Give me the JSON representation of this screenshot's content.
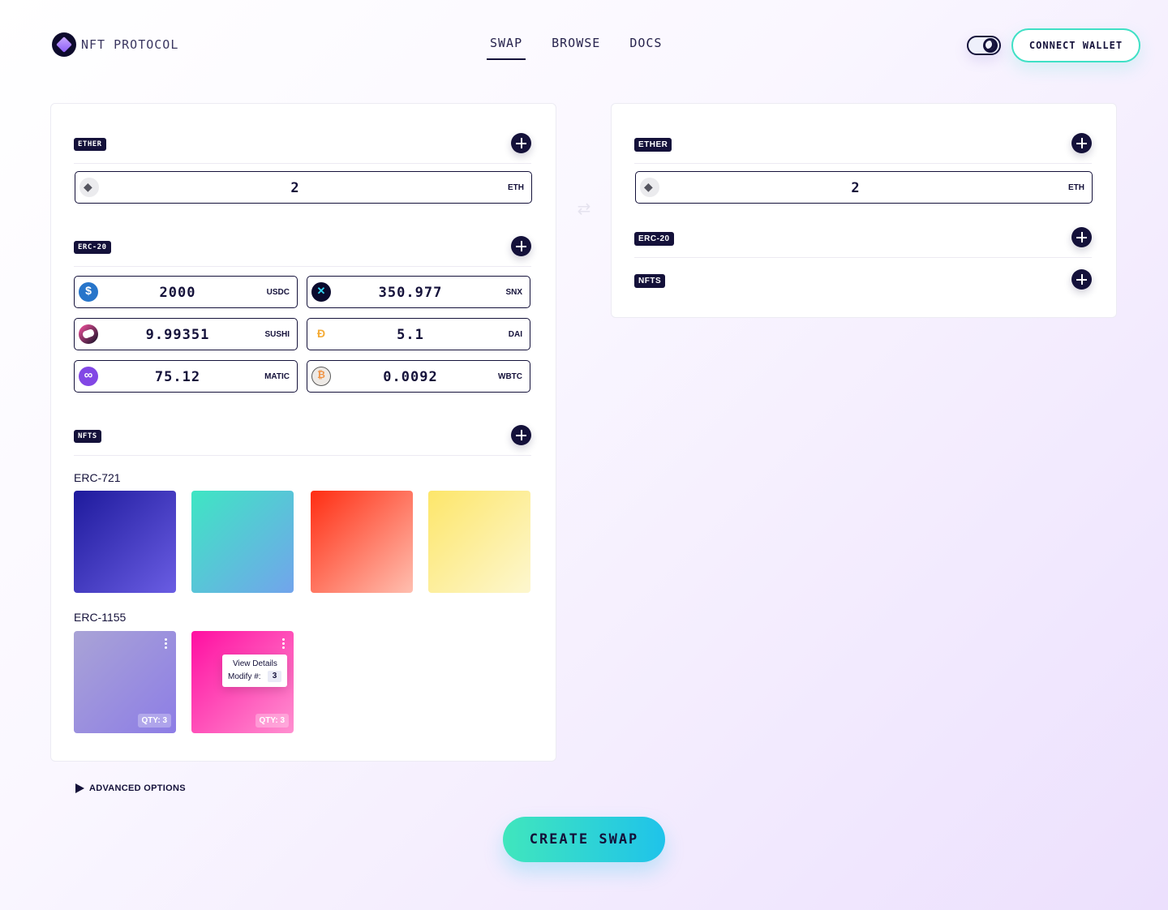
{
  "brand": {
    "name": "NFT PROTOCOL"
  },
  "nav": {
    "items": [
      "SWAP",
      "BROWSE",
      "DOCS"
    ],
    "active": "SWAP"
  },
  "header": {
    "connect_label": "CONNECT WALLET",
    "theme_mode": "dark-moon"
  },
  "left": {
    "ether": {
      "tag": "ETHER",
      "value": "2",
      "unit": "ETH"
    },
    "erc20": {
      "tag": "ERC-20",
      "tokens": [
        {
          "value": "2000",
          "unit": "USDC",
          "icon": "usdc-icon"
        },
        {
          "value": "350.977",
          "unit": "SNX",
          "icon": "snx-icon"
        },
        {
          "value": "9.99351",
          "unit": "SUSHI",
          "icon": "sushi-icon"
        },
        {
          "value": "5.1",
          "unit": "DAI",
          "icon": "dai-icon"
        },
        {
          "value": "75.12",
          "unit": "MATIC",
          "icon": "matic-icon"
        },
        {
          "value": "0.0092",
          "unit": "WBTC",
          "icon": "wbtc-icon"
        }
      ]
    },
    "nfts": {
      "tag": "NFTS",
      "erc721_label": "ERC-721",
      "erc721_colors": [
        "#1e1a9c",
        "#3ee6c3",
        "#ff2d12",
        "#fde66a"
      ],
      "erc1155_label": "ERC-1155",
      "erc1155": [
        {
          "qty": "QTY: 3",
          "color": "#a9a3d6"
        },
        {
          "qty": "QTY: 3",
          "color": "#ff0fa1"
        }
      ],
      "menu": {
        "view_details": "View Details",
        "modify_label": "Modify #:",
        "modify_value": "3"
      }
    }
  },
  "right": {
    "ether": {
      "tag": "ETHER",
      "value": "2",
      "unit": "ETH"
    },
    "erc20_tag": "ERC-20",
    "nfts_tag": "NFTS"
  },
  "advanced_label": "ADVANCED OPTIONS",
  "create_label": "CREATE SWAP",
  "colors": {
    "accent": "#14113a",
    "teal": "#3fe0c5",
    "cyan": "#1fc3ea"
  }
}
